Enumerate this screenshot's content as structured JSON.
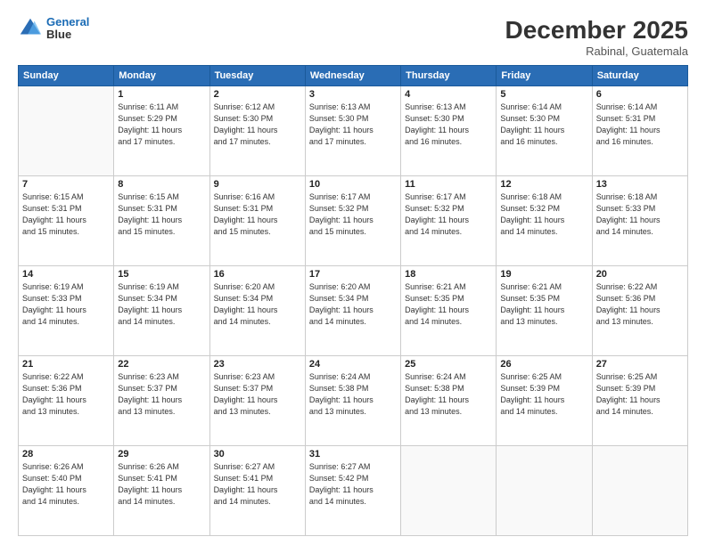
{
  "logo": {
    "line1": "General",
    "line2": "Blue"
  },
  "title": "December 2025",
  "subtitle": "Rabinal, Guatemala",
  "days_of_week": [
    "Sunday",
    "Monday",
    "Tuesday",
    "Wednesday",
    "Thursday",
    "Friday",
    "Saturday"
  ],
  "weeks": [
    [
      {
        "num": "",
        "info": ""
      },
      {
        "num": "1",
        "info": "Sunrise: 6:11 AM\nSunset: 5:29 PM\nDaylight: 11 hours\nand 17 minutes."
      },
      {
        "num": "2",
        "info": "Sunrise: 6:12 AM\nSunset: 5:30 PM\nDaylight: 11 hours\nand 17 minutes."
      },
      {
        "num": "3",
        "info": "Sunrise: 6:13 AM\nSunset: 5:30 PM\nDaylight: 11 hours\nand 17 minutes."
      },
      {
        "num": "4",
        "info": "Sunrise: 6:13 AM\nSunset: 5:30 PM\nDaylight: 11 hours\nand 16 minutes."
      },
      {
        "num": "5",
        "info": "Sunrise: 6:14 AM\nSunset: 5:30 PM\nDaylight: 11 hours\nand 16 minutes."
      },
      {
        "num": "6",
        "info": "Sunrise: 6:14 AM\nSunset: 5:31 PM\nDaylight: 11 hours\nand 16 minutes."
      }
    ],
    [
      {
        "num": "7",
        "info": "Sunrise: 6:15 AM\nSunset: 5:31 PM\nDaylight: 11 hours\nand 15 minutes."
      },
      {
        "num": "8",
        "info": "Sunrise: 6:15 AM\nSunset: 5:31 PM\nDaylight: 11 hours\nand 15 minutes."
      },
      {
        "num": "9",
        "info": "Sunrise: 6:16 AM\nSunset: 5:31 PM\nDaylight: 11 hours\nand 15 minutes."
      },
      {
        "num": "10",
        "info": "Sunrise: 6:17 AM\nSunset: 5:32 PM\nDaylight: 11 hours\nand 15 minutes."
      },
      {
        "num": "11",
        "info": "Sunrise: 6:17 AM\nSunset: 5:32 PM\nDaylight: 11 hours\nand 14 minutes."
      },
      {
        "num": "12",
        "info": "Sunrise: 6:18 AM\nSunset: 5:32 PM\nDaylight: 11 hours\nand 14 minutes."
      },
      {
        "num": "13",
        "info": "Sunrise: 6:18 AM\nSunset: 5:33 PM\nDaylight: 11 hours\nand 14 minutes."
      }
    ],
    [
      {
        "num": "14",
        "info": "Sunrise: 6:19 AM\nSunset: 5:33 PM\nDaylight: 11 hours\nand 14 minutes."
      },
      {
        "num": "15",
        "info": "Sunrise: 6:19 AM\nSunset: 5:34 PM\nDaylight: 11 hours\nand 14 minutes."
      },
      {
        "num": "16",
        "info": "Sunrise: 6:20 AM\nSunset: 5:34 PM\nDaylight: 11 hours\nand 14 minutes."
      },
      {
        "num": "17",
        "info": "Sunrise: 6:20 AM\nSunset: 5:34 PM\nDaylight: 11 hours\nand 14 minutes."
      },
      {
        "num": "18",
        "info": "Sunrise: 6:21 AM\nSunset: 5:35 PM\nDaylight: 11 hours\nand 14 minutes."
      },
      {
        "num": "19",
        "info": "Sunrise: 6:21 AM\nSunset: 5:35 PM\nDaylight: 11 hours\nand 13 minutes."
      },
      {
        "num": "20",
        "info": "Sunrise: 6:22 AM\nSunset: 5:36 PM\nDaylight: 11 hours\nand 13 minutes."
      }
    ],
    [
      {
        "num": "21",
        "info": "Sunrise: 6:22 AM\nSunset: 5:36 PM\nDaylight: 11 hours\nand 13 minutes."
      },
      {
        "num": "22",
        "info": "Sunrise: 6:23 AM\nSunset: 5:37 PM\nDaylight: 11 hours\nand 13 minutes."
      },
      {
        "num": "23",
        "info": "Sunrise: 6:23 AM\nSunset: 5:37 PM\nDaylight: 11 hours\nand 13 minutes."
      },
      {
        "num": "24",
        "info": "Sunrise: 6:24 AM\nSunset: 5:38 PM\nDaylight: 11 hours\nand 13 minutes."
      },
      {
        "num": "25",
        "info": "Sunrise: 6:24 AM\nSunset: 5:38 PM\nDaylight: 11 hours\nand 13 minutes."
      },
      {
        "num": "26",
        "info": "Sunrise: 6:25 AM\nSunset: 5:39 PM\nDaylight: 11 hours\nand 14 minutes."
      },
      {
        "num": "27",
        "info": "Sunrise: 6:25 AM\nSunset: 5:39 PM\nDaylight: 11 hours\nand 14 minutes."
      }
    ],
    [
      {
        "num": "28",
        "info": "Sunrise: 6:26 AM\nSunset: 5:40 PM\nDaylight: 11 hours\nand 14 minutes."
      },
      {
        "num": "29",
        "info": "Sunrise: 6:26 AM\nSunset: 5:41 PM\nDaylight: 11 hours\nand 14 minutes."
      },
      {
        "num": "30",
        "info": "Sunrise: 6:27 AM\nSunset: 5:41 PM\nDaylight: 11 hours\nand 14 minutes."
      },
      {
        "num": "31",
        "info": "Sunrise: 6:27 AM\nSunset: 5:42 PM\nDaylight: 11 hours\nand 14 minutes."
      },
      {
        "num": "",
        "info": ""
      },
      {
        "num": "",
        "info": ""
      },
      {
        "num": "",
        "info": ""
      }
    ]
  ]
}
